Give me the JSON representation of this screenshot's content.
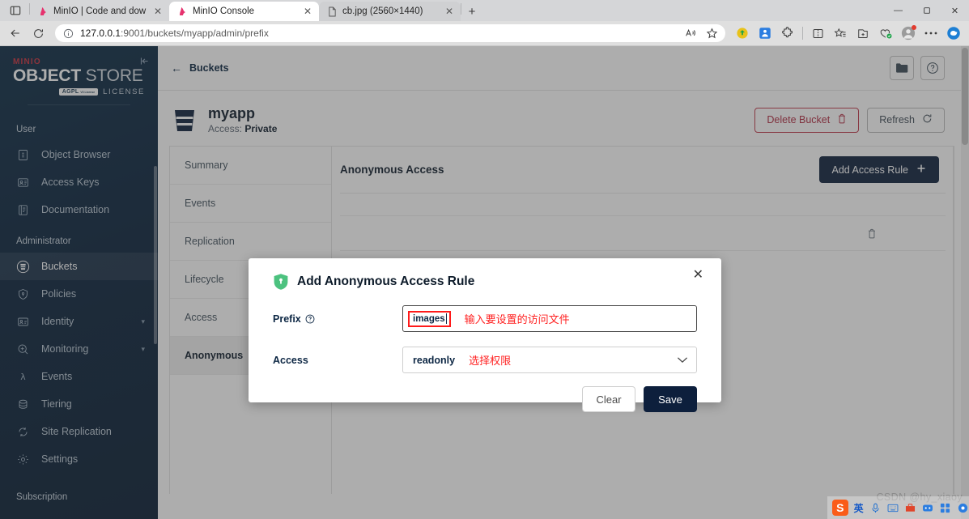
{
  "browser": {
    "tabs": [
      {
        "title": "MinIO | Code and downloads to",
        "favicon": "minio-favicon",
        "active": false
      },
      {
        "title": "MinIO Console",
        "favicon": "minio-favicon",
        "active": true
      },
      {
        "title": "cb.jpg (2560×1440)",
        "favicon": "file-favicon",
        "active": false
      }
    ],
    "new_tab_label": "+",
    "window_controls": {
      "minimize": "—",
      "maximize": "❐",
      "close": "✕"
    },
    "toolbar": {
      "back": "←",
      "reload": "⟳",
      "url_prefix": "127.0.0.1",
      "url_suffix": ":9001/buckets/myapp/admin/prefix",
      "read_aloud": "A",
      "favorite": "☆",
      "extensions_label": "extensions"
    }
  },
  "sidebar": {
    "logo": {
      "brand_top": "MINIO",
      "brand_main_bold": "OBJECT",
      "brand_main_light": "STORE",
      "badge": "AGPL",
      "badge_sub": "V3 License",
      "license_text": "LICENSE"
    },
    "sections": [
      {
        "title": "User",
        "items": [
          {
            "label": "Object Browser",
            "icon": "object-browser-icon",
            "active": false,
            "expandable": false
          },
          {
            "label": "Access Keys",
            "icon": "access-keys-icon",
            "active": false,
            "expandable": false
          },
          {
            "label": "Documentation",
            "icon": "documentation-icon",
            "active": false,
            "expandable": false
          }
        ]
      },
      {
        "title": "Administrator",
        "items": [
          {
            "label": "Buckets",
            "icon": "buckets-icon",
            "active": true,
            "expandable": false
          },
          {
            "label": "Policies",
            "icon": "policies-icon",
            "active": false,
            "expandable": false
          },
          {
            "label": "Identity",
            "icon": "identity-icon",
            "active": false,
            "expandable": true
          },
          {
            "label": "Monitoring",
            "icon": "monitoring-icon",
            "active": false,
            "expandable": true
          },
          {
            "label": "Events",
            "icon": "events-icon",
            "active": false,
            "expandable": false
          },
          {
            "label": "Tiering",
            "icon": "tiering-icon",
            "active": false,
            "expandable": false
          },
          {
            "label": "Site Replication",
            "icon": "site-replication-icon",
            "active": false,
            "expandable": false
          },
          {
            "label": "Settings",
            "icon": "settings-icon",
            "active": false,
            "expandable": false
          }
        ]
      },
      {
        "title": "Subscription",
        "items": []
      }
    ]
  },
  "page": {
    "back_link": "Buckets",
    "header_icons": {
      "folder": "folder-icon",
      "help": "help-icon"
    },
    "bucket": {
      "name": "myapp",
      "access_label": "Access:",
      "access_value": "Private"
    },
    "actions": {
      "delete_bucket": "Delete Bucket",
      "refresh": "Refresh"
    },
    "vtabs": [
      {
        "label": "Summary",
        "active": false
      },
      {
        "label": "Events",
        "active": false
      },
      {
        "label": "Replication",
        "active": false
      },
      {
        "label": "Lifecycle",
        "active": false
      },
      {
        "label": "Access",
        "active": false
      },
      {
        "label": "Anonymous",
        "active": true
      }
    ],
    "panel": {
      "title": "Anonymous Access",
      "add_rule_button": "Add Access Rule",
      "row_delete_icon": "trash-icon"
    }
  },
  "modal": {
    "title": "Add Anonymous Access Rule",
    "icon": "shield-lock-icon",
    "close": "✕",
    "prefix": {
      "label": "Prefix",
      "help_icon": "help-circle-icon",
      "value": "images",
      "annotation": "输入要设置的访问文件"
    },
    "access": {
      "label": "Access",
      "value": "readonly",
      "annotation": "选择权限",
      "chevron": "chevron-down-icon"
    },
    "buttons": {
      "clear": "Clear",
      "save": "Save"
    }
  },
  "watermark": {
    "text": "CSDN @hy_xiaoy"
  },
  "ime": {
    "logo": "S",
    "mode": "英",
    "icons": [
      "mic-icon",
      "keyboard-icon",
      "toolbox-icon",
      "screenshot-icon",
      "apps-icon",
      "settings-icon"
    ]
  },
  "colors": {
    "brand_navy": "#0d1f3c",
    "sidebar_bg": "#07203a",
    "danger": "#b02a40",
    "annotation_red": "#ff2222",
    "shield_green": "#4cc27f"
  }
}
